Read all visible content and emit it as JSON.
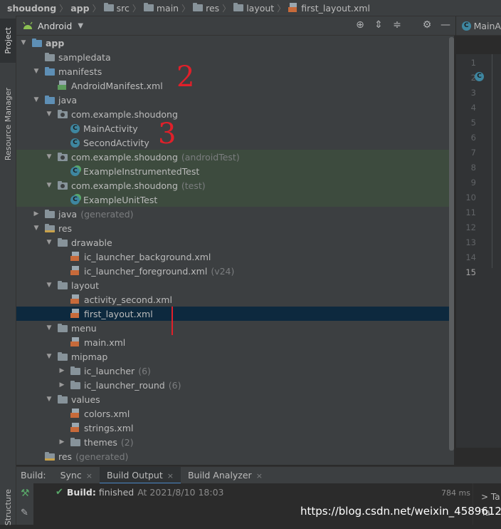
{
  "breadcrumb": {
    "items": [
      {
        "label": "shoudong",
        "bold": true
      },
      {
        "label": "app",
        "bold": true
      },
      {
        "label": "src"
      },
      {
        "label": "main"
      },
      {
        "label": "res"
      },
      {
        "label": "layout"
      },
      {
        "label": "first_layout.xml"
      }
    ]
  },
  "left_strip": {
    "project_label": "Project",
    "resource_manager_label": "Resource Manager",
    "structure_label": "Structure"
  },
  "project_panel": {
    "view_selector": "Android",
    "toolbar_icons": [
      "locate-icon",
      "expand-all-icon",
      "collapse-all-icon",
      "gear-icon",
      "minimize-icon"
    ]
  },
  "tree": [
    {
      "label": "app",
      "suffix": "",
      "indent": 0,
      "arrow": "down",
      "icon": "module",
      "bold": true
    },
    {
      "label": "sampledata",
      "suffix": "",
      "indent": 1,
      "arrow": "",
      "icon": "folder"
    },
    {
      "label": "manifests",
      "suffix": "",
      "indent": 1,
      "arrow": "down",
      "icon": "folder-blue"
    },
    {
      "label": "AndroidManifest.xml",
      "suffix": "",
      "indent": 2,
      "arrow": "",
      "icon": "manifest"
    },
    {
      "label": "java",
      "suffix": "",
      "indent": 1,
      "arrow": "down",
      "icon": "folder-blue"
    },
    {
      "label": "com.example.shoudong",
      "suffix": "",
      "indent": 2,
      "arrow": "down",
      "icon": "package"
    },
    {
      "label": "MainActivity",
      "suffix": "",
      "indent": 3,
      "arrow": "",
      "icon": "class"
    },
    {
      "label": "SecondActivity",
      "suffix": "",
      "indent": 3,
      "arrow": "",
      "icon": "class"
    },
    {
      "label": "com.example.shoudong",
      "suffix": "(androidTest)",
      "indent": 2,
      "arrow": "down",
      "icon": "package",
      "test": true
    },
    {
      "label": "ExampleInstrumentedTest",
      "suffix": "",
      "indent": 3,
      "arrow": "",
      "icon": "test-class",
      "test": true
    },
    {
      "label": "com.example.shoudong",
      "suffix": "(test)",
      "indent": 2,
      "arrow": "down",
      "icon": "package",
      "test": true
    },
    {
      "label": "ExampleUnitTest",
      "suffix": "",
      "indent": 3,
      "arrow": "",
      "icon": "test-class",
      "test": true
    },
    {
      "label": "java",
      "suffix": "(generated)",
      "indent": 1,
      "arrow": "right",
      "icon": "folder-gen"
    },
    {
      "label": "res",
      "suffix": "",
      "indent": 1,
      "arrow": "down",
      "icon": "res-folder"
    },
    {
      "label": "drawable",
      "suffix": "",
      "indent": 2,
      "arrow": "down",
      "icon": "folder"
    },
    {
      "label": "ic_launcher_background.xml",
      "suffix": "",
      "indent": 3,
      "arrow": "",
      "icon": "xml"
    },
    {
      "label": "ic_launcher_foreground.xml",
      "suffix": "(v24)",
      "indent": 3,
      "arrow": "",
      "icon": "xml"
    },
    {
      "label": "layout",
      "suffix": "",
      "indent": 2,
      "arrow": "down",
      "icon": "folder"
    },
    {
      "label": "activity_second.xml",
      "suffix": "",
      "indent": 3,
      "arrow": "",
      "icon": "xml"
    },
    {
      "label": "first_layout.xml",
      "suffix": "",
      "indent": 3,
      "arrow": "",
      "icon": "xml",
      "selected": true
    },
    {
      "label": "menu",
      "suffix": "",
      "indent": 2,
      "arrow": "down",
      "icon": "folder"
    },
    {
      "label": "main.xml",
      "suffix": "",
      "indent": 3,
      "arrow": "",
      "icon": "xml"
    },
    {
      "label": "mipmap",
      "suffix": "",
      "indent": 2,
      "arrow": "down",
      "icon": "folder"
    },
    {
      "label": "ic_launcher",
      "suffix": "(6)",
      "indent": 3,
      "arrow": "right",
      "icon": "folder"
    },
    {
      "label": "ic_launcher_round",
      "suffix": "(6)",
      "indent": 3,
      "arrow": "right",
      "icon": "folder"
    },
    {
      "label": "values",
      "suffix": "",
      "indent": 2,
      "arrow": "down",
      "icon": "folder"
    },
    {
      "label": "colors.xml",
      "suffix": "",
      "indent": 3,
      "arrow": "",
      "icon": "xml"
    },
    {
      "label": "strings.xml",
      "suffix": "",
      "indent": 3,
      "arrow": "",
      "icon": "xml"
    },
    {
      "label": "themes",
      "suffix": "(2)",
      "indent": 3,
      "arrow": "right",
      "icon": "folder"
    },
    {
      "label": "res",
      "suffix": "(generated)",
      "indent": 1,
      "arrow": "",
      "icon": "res-folder"
    }
  ],
  "editor": {
    "tab_label": "MainA",
    "line_numbers": [
      "1",
      "2",
      "3",
      "4",
      "5",
      "6",
      "7",
      "8",
      "9",
      "10",
      "11",
      "12",
      "13",
      "14",
      "15"
    ],
    "current_line": "15"
  },
  "build": {
    "title": "Build:",
    "tabs": [
      {
        "label": "Sync",
        "active": false
      },
      {
        "label": "Build Output",
        "active": true
      },
      {
        "label": "Build Analyzer",
        "active": false
      }
    ],
    "status_bold": "Build:",
    "status_text": "finished",
    "status_time": "At 2021/8/10 18:03",
    "duration": "784 ms",
    "right_lines": [
      "> Ta",
      "Ta"
    ]
  },
  "annotations": {
    "mark_2": "2",
    "mark_3": "3"
  },
  "watermark": "https://blog.csdn.net/weixin_45896126",
  "colors": {
    "selection": "#0d293e",
    "test_row": "#3d4b3e",
    "annotation_red": "#e0202a",
    "success_green": "#59a869"
  }
}
